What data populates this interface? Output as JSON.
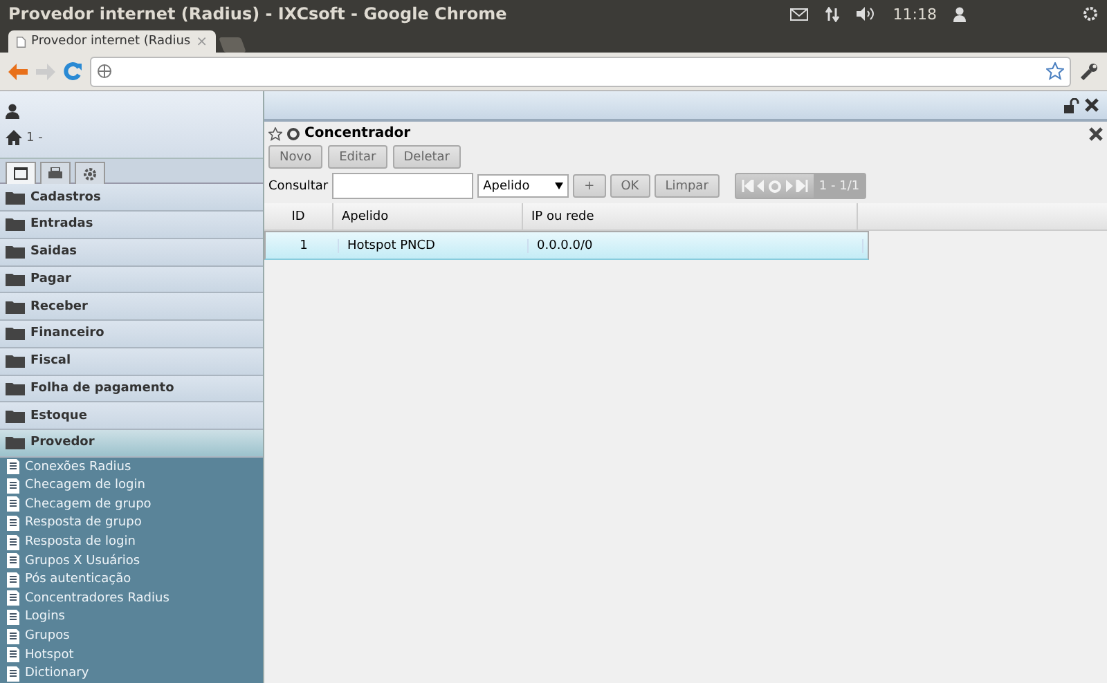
{
  "window": {
    "title": "Provedor internet (Radius) - IXCsoft - Google Chrome"
  },
  "top_panel": {
    "time": "11:18"
  },
  "browser": {
    "tabs": [
      {
        "label": "Provedor internet (Radius",
        "selected": true,
        "close": "×"
      }
    ]
  },
  "sidebar": {
    "company_prefix": "1 -",
    "tabs": [
      {
        "selected": true
      },
      {
        "selected": false
      },
      {
        "selected": false
      }
    ],
    "items": [
      {
        "label": "Cadastros",
        "expanded": false
      },
      {
        "label": "Entradas",
        "expanded": false
      },
      {
        "label": "Saidas",
        "expanded": false
      },
      {
        "label": "Pagar",
        "expanded": false
      },
      {
        "label": "Receber",
        "expanded": false
      },
      {
        "label": "Financeiro",
        "expanded": false
      },
      {
        "label": "Fiscal",
        "expanded": false
      },
      {
        "label": "Folha de pagamento",
        "expanded": false
      },
      {
        "label": "Estoque",
        "expanded": false
      },
      {
        "label": "Provedor",
        "expanded": true,
        "children": [
          {
            "label": "Conexões Radius"
          },
          {
            "label": "Checagem de login"
          },
          {
            "label": "Checagem de grupo"
          },
          {
            "label": "Resposta de grupo"
          },
          {
            "label": "Resposta de login"
          },
          {
            "label": "Grupos X Usuários"
          },
          {
            "label": "Pós autenticação"
          },
          {
            "label": "Concentradores Radius"
          },
          {
            "label": "Logins"
          },
          {
            "label": "Grupos"
          },
          {
            "label": "Hotspot"
          },
          {
            "label": "Dictionary"
          }
        ]
      }
    ]
  },
  "panel": {
    "title": "Concentrador",
    "buttons": [
      {
        "label": "Novo",
        "disabled": true
      },
      {
        "label": "Editar",
        "disabled": true
      },
      {
        "label": "Deletar",
        "disabled": true
      }
    ],
    "search": {
      "label": "Consultar",
      "field": "Apelido",
      "buttons": [
        {
          "label": "+",
          "disabled": true
        },
        {
          "label": "OK",
          "disabled": true
        },
        {
          "label": "Limpar",
          "disabled": true
        }
      ],
      "pager": "1 - 1/1"
    },
    "table": {
      "columns": [
        "ID",
        "Apelido",
        "IP ou rede"
      ],
      "rows": [
        {
          "cells": [
            "1",
            "Hotspot PNCD",
            "0.0.0.0/0"
          ],
          "selected": true
        }
      ]
    }
  }
}
